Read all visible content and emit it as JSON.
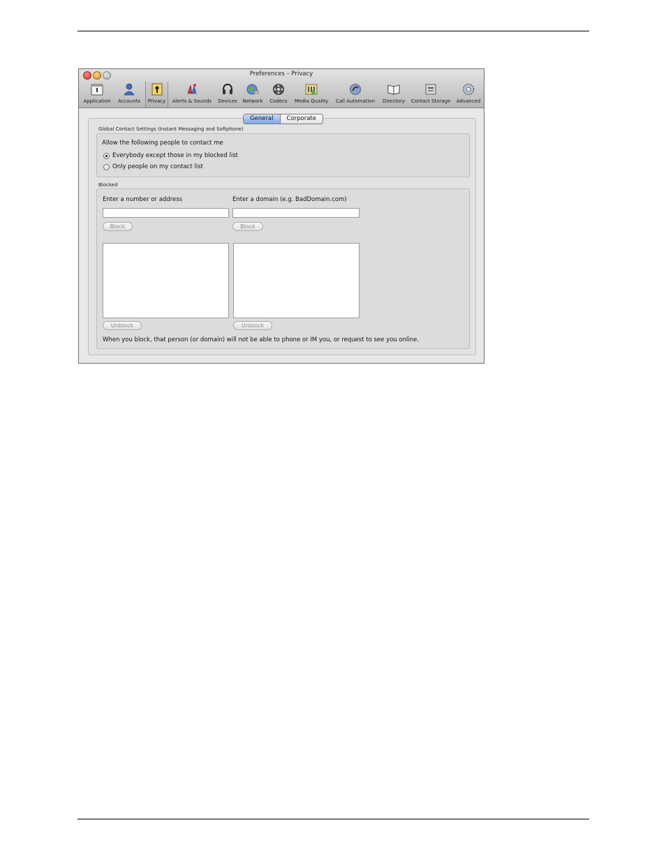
{
  "window": {
    "title": "Preferences – Privacy"
  },
  "toolbar": {
    "items": [
      {
        "label": "Application",
        "icon": "application-icon"
      },
      {
        "label": "Accounts",
        "icon": "accounts-icon"
      },
      {
        "label": "Privacy",
        "icon": "privacy-icon",
        "selected": true
      },
      {
        "label": "Alerts & Sounds",
        "icon": "alerts-sounds-icon"
      },
      {
        "label": "Devices",
        "icon": "devices-icon"
      },
      {
        "label": "Network",
        "icon": "network-icon"
      },
      {
        "label": "Codecs",
        "icon": "codecs-icon"
      },
      {
        "label": "Media Quality",
        "icon": "media-quality-icon"
      },
      {
        "label": "Call Automation",
        "icon": "call-automation-icon"
      },
      {
        "label": "Directory",
        "icon": "directory-icon"
      },
      {
        "label": "Contact Storage",
        "icon": "contact-storage-icon"
      },
      {
        "label": "Advanced",
        "icon": "advanced-icon"
      }
    ]
  },
  "tabs": {
    "general": "General",
    "corporate": "Corporate",
    "selected": "General"
  },
  "global_contact": {
    "title": "Global Contact Settings (Instant Messaging and Softphone)",
    "prompt": "Allow the following people to contact me",
    "options": [
      {
        "label": "Everybody except those in my blocked list",
        "checked": true
      },
      {
        "label": "Only people on my contact list",
        "checked": false
      }
    ]
  },
  "blocked": {
    "title": "Blocked",
    "address_label": "Enter a number or address",
    "address_value": "",
    "domain_label": "Enter a domain (e.g. BadDomain.com)",
    "domain_value": "",
    "block_button": "Block",
    "unblock_button": "Unblock",
    "note": "When you block, that person (or domain) will not be able to phone or IM you, or request to see you online."
  },
  "colors": {
    "selected_tab": "#7ea9e8",
    "window_bg": "#e8e8e8",
    "titlebar": "#c4c4c4"
  }
}
